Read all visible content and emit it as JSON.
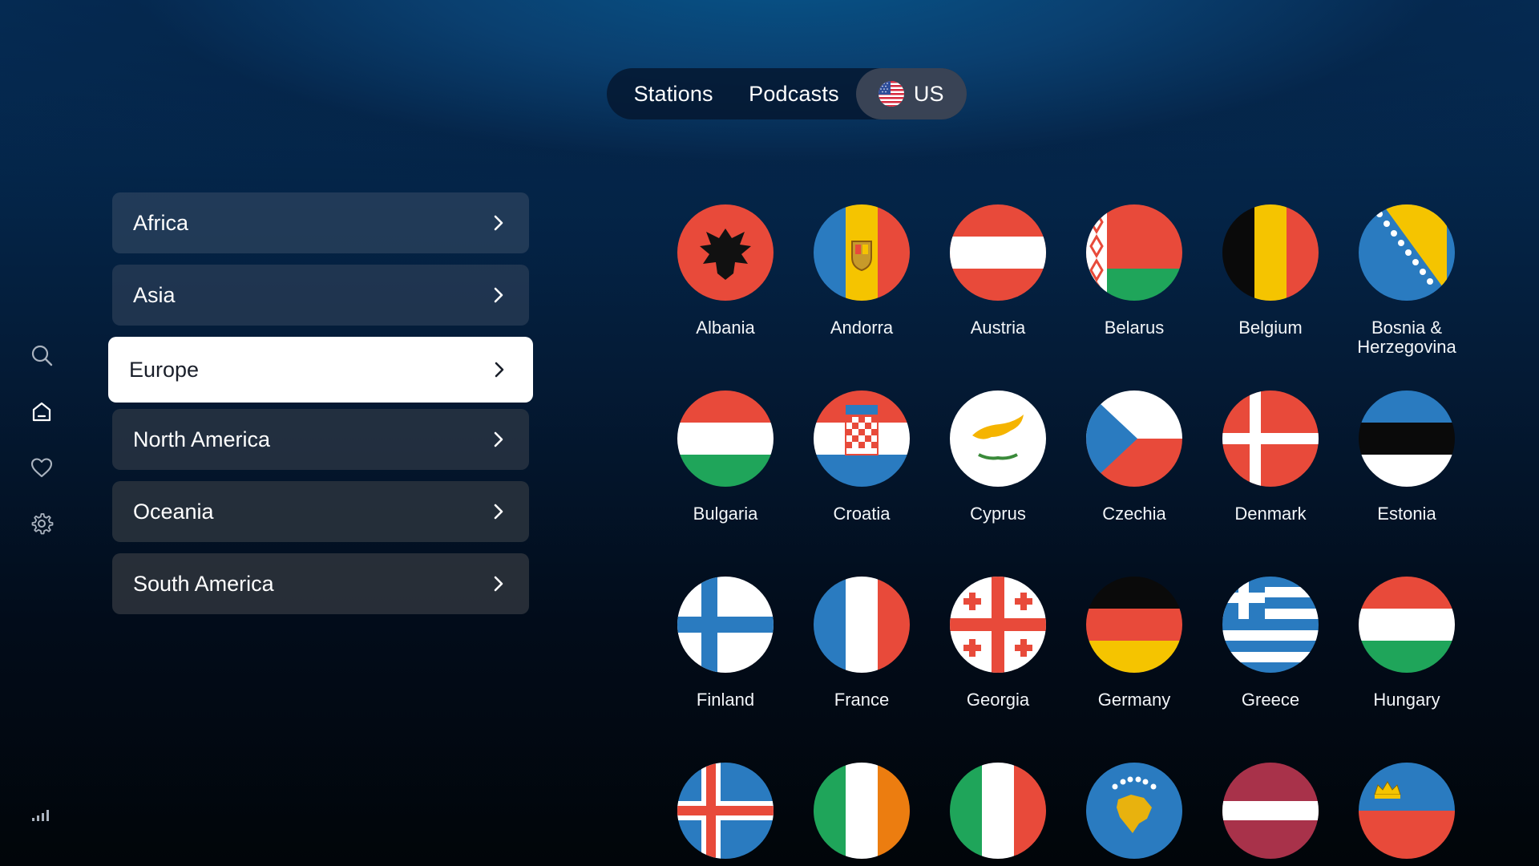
{
  "nav": {
    "stations_label": "Stations",
    "podcasts_label": "Podcasts",
    "region_label": "US"
  },
  "sidebar": {
    "icons": [
      "search-icon",
      "home-icon",
      "heart-icon",
      "settings-icon",
      "signal-icon"
    ]
  },
  "regions": [
    {
      "label": "Africa"
    },
    {
      "label": "Asia"
    },
    {
      "label": "Europe",
      "selected": true
    },
    {
      "label": "North America"
    },
    {
      "label": "Oceania"
    },
    {
      "label": "South America"
    }
  ],
  "countries": [
    {
      "name": "Albania"
    },
    {
      "name": "Andorra"
    },
    {
      "name": "Austria"
    },
    {
      "name": "Belarus"
    },
    {
      "name": "Belgium"
    },
    {
      "name": "Bosnia &\nHerzegovina"
    },
    {
      "name": "Bulgaria"
    },
    {
      "name": "Croatia"
    },
    {
      "name": "Cyprus"
    },
    {
      "name": "Czechia"
    },
    {
      "name": "Denmark"
    },
    {
      "name": "Estonia"
    },
    {
      "name": "Finland"
    },
    {
      "name": "France"
    },
    {
      "name": "Georgia"
    },
    {
      "name": "Germany"
    },
    {
      "name": "Greece"
    },
    {
      "name": "Hungary"
    },
    {
      "name": ""
    },
    {
      "name": ""
    },
    {
      "name": ""
    },
    {
      "name": ""
    },
    {
      "name": ""
    },
    {
      "name": ""
    }
  ],
  "colors": {
    "red": "#e84a3a",
    "blue": "#2a7bc0",
    "white": "#ffffff",
    "green": "#1fa55a",
    "yellow": "#f5c400",
    "black": "#0a0a0a",
    "selected_bg": "#ffffff"
  }
}
